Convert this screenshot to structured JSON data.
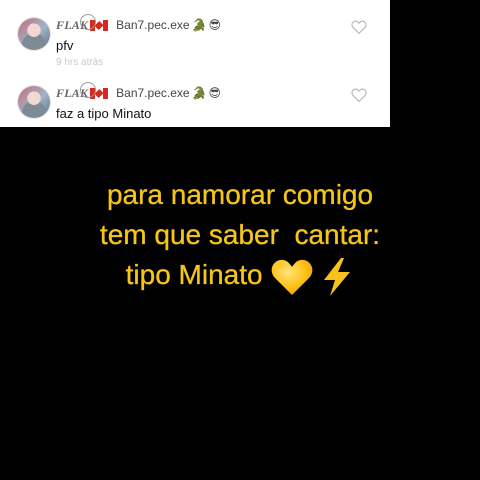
{
  "comments": [
    {
      "username_prefix": "FLAK",
      "handle": "Ban7.pec.exe",
      "badges": [
        "canada-flag",
        "crocodile-emoji",
        "sunglasses-emoji"
      ],
      "text": "pfv",
      "timestamp": "9 hrs atrás"
    },
    {
      "username_prefix": "FLAK",
      "handle": "Ban7.pec.exe",
      "badges": [
        "canada-flag",
        "crocodile-emoji",
        "sunglasses-emoji"
      ],
      "text": "faz a tipo Minato",
      "timestamp": ""
    }
  ],
  "caption": {
    "line1": "para namorar comigo",
    "line2": "tem que saber  cantar:",
    "line3": "tipo Minato",
    "emojis": [
      "yellow-heart",
      "high-voltage"
    ]
  },
  "colors": {
    "caption": "#f5c518",
    "background": "#000000",
    "panel": "#ffffff"
  }
}
